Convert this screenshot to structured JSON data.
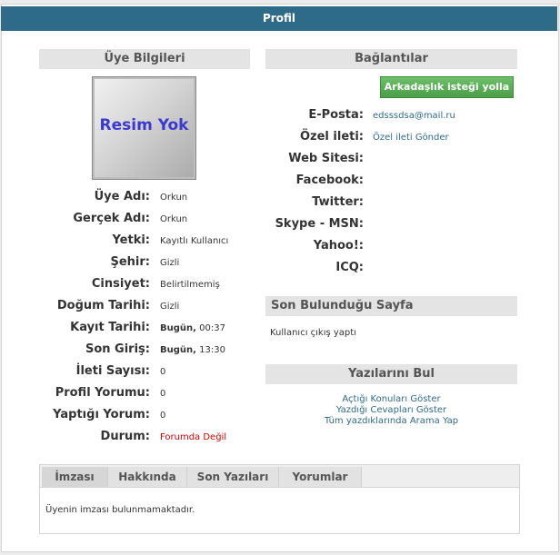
{
  "page": {
    "title": "Profil"
  },
  "member_info": {
    "heading": "Üye Bilgileri",
    "avatar_text": "Resim Yok",
    "rows": [
      {
        "label": "Üye Adı:",
        "value": "Orkun"
      },
      {
        "label": "Gerçek Adı:",
        "value": "Orkun"
      },
      {
        "label": "Yetki:",
        "value": "Kayıtlı Kullanıcı"
      },
      {
        "label": "Şehir:",
        "value": "Gizli"
      },
      {
        "label": "Cinsiyet:",
        "value": "Belirtilmemiş"
      },
      {
        "label": "Doğum Tarihi:",
        "value": "Gizli"
      },
      {
        "label": "Kayıt Tarihi:",
        "value_bold": "Bugün,",
        "value": " 00:37"
      },
      {
        "label": "Son Giriş:",
        "value_bold": "Bugün,",
        "value": " 13:30"
      },
      {
        "label": "İleti Sayısı:",
        "value": "0"
      },
      {
        "label": "Profil Yorumu:",
        "value": "0"
      },
      {
        "label": "Yaptığı Yorum:",
        "value": "0"
      },
      {
        "label": "Durum:",
        "value": "Forumda Değil"
      }
    ]
  },
  "connections": {
    "heading": "Bağlantılar",
    "friend_button": "Arkadaşlık isteği yolla",
    "rows": [
      {
        "label": "E-Posta:",
        "value": "edsssdsa@mail.ru"
      },
      {
        "label": "Özel ileti:",
        "value": "Özel ileti Gönder"
      },
      {
        "label": "Web Sitesi:",
        "value": ""
      },
      {
        "label": "Facebook:",
        "value": ""
      },
      {
        "label": "Twitter:",
        "value": ""
      },
      {
        "label": "Skype - MSN:",
        "value": ""
      },
      {
        "label": "Yahoo!:",
        "value": ""
      },
      {
        "label": "ICQ:",
        "value": ""
      }
    ]
  },
  "last_page": {
    "heading": "Son Bulunduğu Sayfa",
    "text": "Kullanıcı çıkış yaptı"
  },
  "find_posts": {
    "heading": "Yazılarını Bul",
    "links": [
      "Açtığı Konuları Göster",
      "Yazdığı Cevapları Göster",
      "Tüm yazdıklarında Arama Yap"
    ]
  },
  "tabs": {
    "items": [
      "İmzası",
      "Hakkında",
      "Son Yazıları",
      "Yorumlar"
    ],
    "active": "İmzası",
    "content": "Üyenin imzası bulunmamaktadır."
  },
  "colors": {
    "title_bar": "#2e6b88",
    "button": "#4fa84c",
    "offline": "#d00000",
    "link": "#2e6b88"
  }
}
